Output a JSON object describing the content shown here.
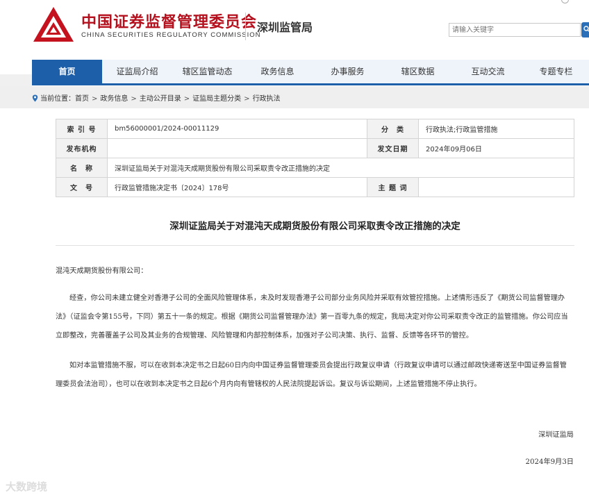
{
  "header": {
    "org_cn": "中国证券监督管理委员会",
    "org_en": "CHINA SECURITIES REGULATORY COMMISSION",
    "sub_org": "深圳监管局",
    "search_placeholder": "请输入关键字",
    "brand_color": "#b5101d"
  },
  "nav": {
    "accent": "#1d5fa8",
    "items": [
      {
        "label": "首页"
      },
      {
        "label": "证监局介绍"
      },
      {
        "label": "辖区监管动态"
      },
      {
        "label": "政务信息"
      },
      {
        "label": "办事服务"
      },
      {
        "label": "辖区数据"
      },
      {
        "label": "互动交流"
      },
      {
        "label": "专题专栏"
      }
    ]
  },
  "breadcrumb": {
    "prefix": "当前位置：",
    "items": [
      "首页",
      "政务信息",
      "主动公开目录",
      "证监局主题分类",
      "行政执法"
    ],
    "separator": ">"
  },
  "meta": {
    "index_label": "索 引 号",
    "index_value": "bm56000001/2024-00011129",
    "category_label": "分　类",
    "category_value": "行政执法;行政监管措施",
    "issuer_label": "发布机构",
    "issuer_value": "",
    "date_label": "发文日期",
    "date_value": "2024年09月06日",
    "name_label": "名　称",
    "name_value": "深圳证监局关于对混沌天成期货股份有限公司采取责令改正措施的决定",
    "docno_label": "文　号",
    "docno_value": "行政监管措施决定书〔2024〕178号",
    "keywords_label": "主 题 词",
    "keywords_value": ""
  },
  "document": {
    "title": "深圳证监局关于对混沌天成期货股份有限公司采取责令改正措施的决定",
    "addressee": "混沌天成期货股份有限公司：",
    "para1": "经查，你公司未建立健全对香港子公司的全面风险管理体系，未及时发现香港子公司部分业务风险并采取有效管控措施。上述情形违反了《期货公司监督管理办法》（证监会令第155号，下同）第五十一条的规定。根据《期货公司监督管理办法》第一百零九条的规定，我局决定对你公司采取责令改正的监管措施。你公司应当立即整改，完善覆盖子公司及其业务的合规管理、风险管理和内部控制体系，加强对子公司决策、执行、监督、反馈等各环节的管控。",
    "para2": "如对本监管措施不服，可以在收到本决定书之日起60日内向中国证券监督管理委员会提出行政复议申请（行政复议申请可以通过邮政快递寄送至中国证券监督管理委员会法治司），也可以在收到本决定书之日起6个月内向有管辖权的人民法院提起诉讼。复议与诉讼期间，上述监管措施不停止执行。",
    "signature": "深圳证监局",
    "date": "2024年9月3日"
  },
  "watermark": "大数跨境"
}
